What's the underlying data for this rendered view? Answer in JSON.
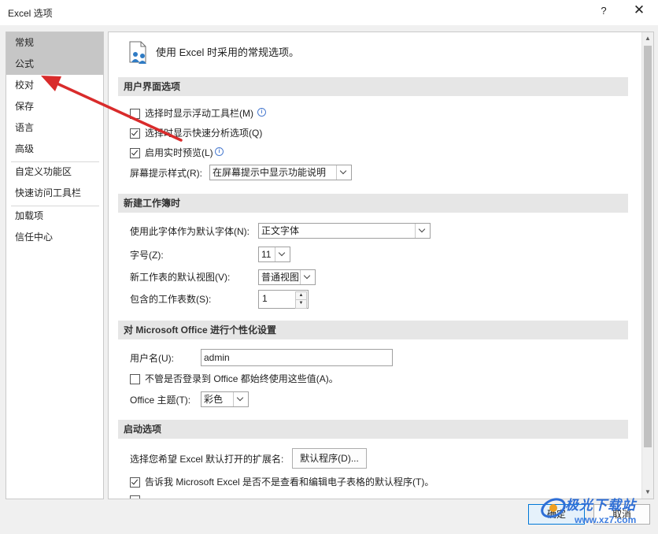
{
  "window": {
    "title": "Excel 选项",
    "help": "?",
    "close": "✕"
  },
  "sidebar": {
    "items": [
      "常规",
      "公式",
      "校对",
      "保存",
      "语言",
      "高级",
      "自定义功能区",
      "快速访问工具栏",
      "加载项",
      "信任中心"
    ],
    "selected": [
      "常规",
      "公式"
    ]
  },
  "header": {
    "text": "使用 Excel 时采用的常规选项。"
  },
  "sections": {
    "ui": {
      "title": "用户界面选项",
      "mini_toolbar": {
        "label": "选择时显示浮动工具栏(M)",
        "checked": false
      },
      "quick_analysis": {
        "label": "选择时显示快速分析选项(Q)",
        "checked": true
      },
      "live_preview": {
        "label": "启用实时预览(L)",
        "checked": true
      },
      "screentip": {
        "label": "屏幕提示样式(R):",
        "value": "在屏幕提示中显示功能说明"
      }
    },
    "new_workbook": {
      "title": "新建工作簿时",
      "font": {
        "label": "使用此字体作为默认字体(N):",
        "value": "正文字体"
      },
      "size": {
        "label": "字号(Z):",
        "value": "11"
      },
      "view": {
        "label": "新工作表的默认视图(V):",
        "value": "普通视图"
      },
      "sheets": {
        "label": "包含的工作表数(S):",
        "value": "1"
      }
    },
    "personalize": {
      "title": "对 Microsoft Office 进行个性化设置",
      "username": {
        "label": "用户名(U):",
        "value": "admin"
      },
      "always_use": {
        "label": "不管是否登录到 Office 都始终使用这些值(A)。",
        "checked": false
      },
      "theme": {
        "label": "Office 主题(T):",
        "value": "彩色"
      }
    },
    "startup": {
      "title": "启动选项",
      "ext": {
        "label": "选择您希望 Excel 默认打开的扩展名:",
        "button": "默认程序(D)..."
      },
      "tell_me": {
        "label": "告诉我 Microsoft Excel 是否不是查看和编辑电子表格的默认程序(T)。",
        "checked": true
      }
    }
  },
  "footer": {
    "ok": "确定",
    "cancel": "取消"
  },
  "watermark": {
    "brand": "极光下载站",
    "url": "www.xz7.com"
  },
  "colors": {
    "selected_bg": "#c6c6c6",
    "section_bg": "#e6e6e6",
    "annotation_arrow": "#d92b2b",
    "accent": "#0078d7"
  }
}
